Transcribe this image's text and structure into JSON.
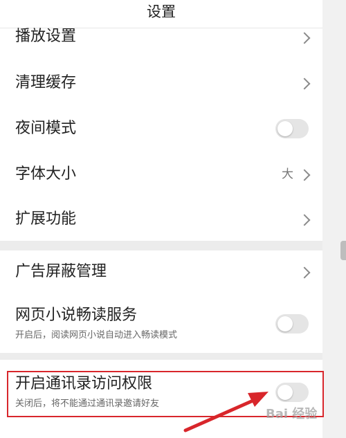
{
  "header": {
    "title": "设置"
  },
  "group1": [
    {
      "label": "播放设置",
      "control": "chevron"
    },
    {
      "label": "清理缓存",
      "control": "chevron"
    },
    {
      "label": "夜间模式",
      "control": "toggle",
      "on": false
    },
    {
      "label": "字体大小",
      "control": "chevron",
      "value": "大"
    },
    {
      "label": "扩展功能",
      "control": "chevron"
    }
  ],
  "group2": [
    {
      "label": "广告屏蔽管理",
      "control": "chevron"
    },
    {
      "label": "网页小说畅读服务",
      "subtitle": "开启后，阅读网页小说自动进入畅读模式",
      "control": "toggle",
      "on": false
    }
  ],
  "group3": [
    {
      "label": "开启通讯录访问权限",
      "subtitle": "关闭后，将不能通过通讯录邀请好友",
      "control": "toggle",
      "on": false
    }
  ],
  "watermark": "Bai 经验",
  "colors": {
    "highlight": "#d8262b",
    "toggle_off": "#e5e5e5",
    "background": "#ececec"
  }
}
